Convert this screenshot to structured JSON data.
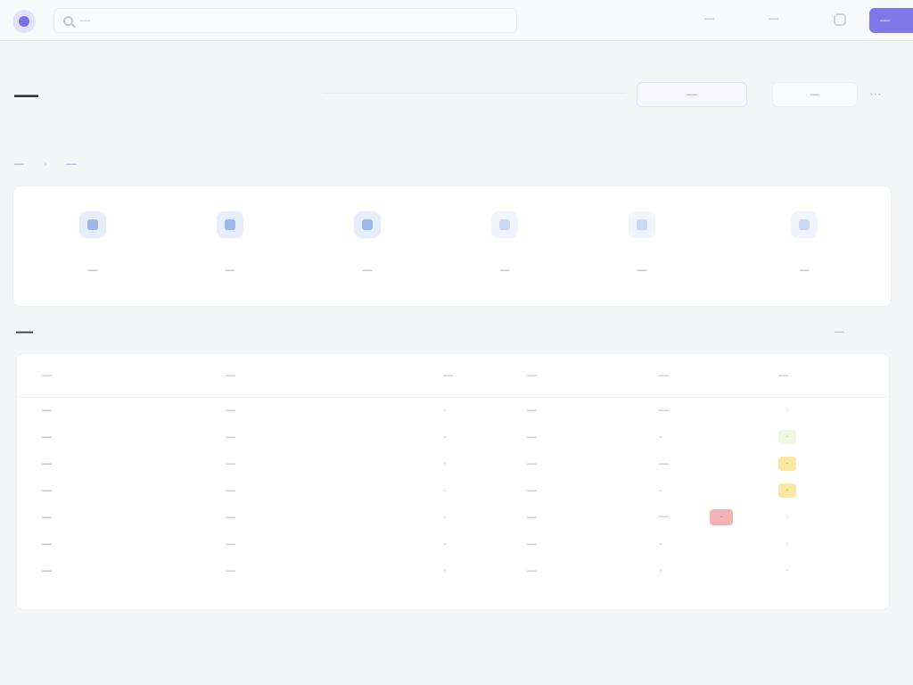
{
  "colors": {
    "accent": "#7f78e8",
    "danger": "#f1b3b3",
    "warning": "#fbe7a4",
    "success": "#eef7e2",
    "icon_tint": "#9db7ea"
  },
  "topbar": {
    "search_text": "—",
    "nav_links": [
      "—",
      "—"
    ],
    "primary_label": "—"
  },
  "header": {
    "title": "—",
    "outline_button": "—",
    "plain_button": "—",
    "more": "⋯"
  },
  "breadcrumbs": [
    "—",
    "—"
  ],
  "quick_actions": [
    {
      "label": "—",
      "icon": "grid-icon"
    },
    {
      "label": "—",
      "icon": "mail-icon"
    },
    {
      "label": "—",
      "icon": "grid-icon"
    },
    {
      "label": "—",
      "icon": "document-icon"
    },
    {
      "label": "—",
      "icon": "document-icon"
    },
    {
      "label": "—",
      "icon": "document-icon"
    }
  ],
  "section": {
    "title": "—",
    "view_all": "—"
  },
  "table": {
    "headers": [
      "—",
      "—",
      "—",
      "—",
      "—",
      "—"
    ],
    "rows": [
      {
        "name": "—",
        "desc": "—",
        "num": "·",
        "date": "—",
        "status": "—",
        "badge": "",
        "score": "·",
        "score_style": "none"
      },
      {
        "name": "—",
        "desc": "—",
        "num": "·",
        "date": "—",
        "status": "·",
        "badge": "",
        "score": "·",
        "score_style": "green"
      },
      {
        "name": "—",
        "desc": "—",
        "num": "·",
        "date": "—",
        "status": "—",
        "badge": "",
        "score": "·",
        "score_style": "yellow"
      },
      {
        "name": "—",
        "desc": "—",
        "num": "·",
        "date": "—",
        "status": "·",
        "badge": "",
        "score": "·",
        "score_style": "yellow"
      },
      {
        "name": "—",
        "desc": "—",
        "num": "·",
        "date": "—",
        "status": "—",
        "badge": "·",
        "score": "·",
        "score_style": "none"
      },
      {
        "name": "—",
        "desc": "—",
        "num": "·",
        "date": "—",
        "status": "·",
        "badge": "",
        "score": "·",
        "score_style": "none"
      },
      {
        "name": "—",
        "desc": "—",
        "num": "·",
        "date": "—",
        "status": "·",
        "badge": "",
        "score": "·",
        "score_style": "none"
      }
    ]
  }
}
